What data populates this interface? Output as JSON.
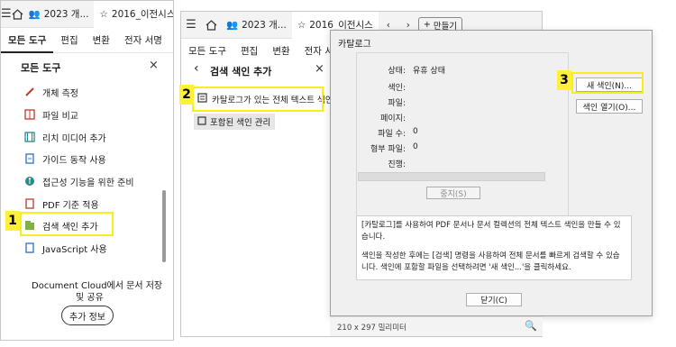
{
  "window1": {
    "tabs": [
      "2023 개...",
      "2016_이전시스"
    ],
    "menu": [
      "모든 도구",
      "편집",
      "변환",
      "전자 서명"
    ],
    "panel_title": "모든 도구",
    "tools": [
      {
        "label": "개체 측정",
        "icon": "ruler-icon"
      },
      {
        "label": "파일 비교",
        "icon": "compare-icon"
      },
      {
        "label": "리치 미디어 추가",
        "icon": "film-icon"
      },
      {
        "label": "가이드 동작 사용",
        "icon": "guide-icon"
      },
      {
        "label": "접근성 기능을 위한 준비",
        "icon": "accessibility-icon"
      },
      {
        "label": "PDF 기준 적용",
        "icon": "pdf-standard-icon"
      },
      {
        "label": "검색 색인 추가",
        "icon": "index-icon"
      },
      {
        "label": "JavaScript 사용",
        "icon": "javascript-icon"
      }
    ],
    "promo_text_1": "Document Cloud에서 문서 저장",
    "promo_text_2": "및 공유",
    "more_info": "추가 정보"
  },
  "window2": {
    "tabs": [
      "2023 개...",
      "2016_이전시스"
    ],
    "new_label": "만들기",
    "menu": [
      "모든 도구",
      "편집",
      "변환",
      "전자 서명"
    ],
    "panel_title": "검색 색인 추가",
    "options": [
      {
        "label": "카탈로그가 있는 전체 텍스트 색인",
        "icon": "catalog-icon"
      },
      {
        "label": "포함된 색인 관리",
        "icon": "embedded-index-icon"
      }
    ],
    "status_text": "210 x 297 밀리미터"
  },
  "dialog": {
    "title": "카탈로그",
    "fields": [
      {
        "label": "상태:",
        "value": "유휴 상태"
      },
      {
        "label": "색인:",
        "value": ""
      },
      {
        "label": "파일:",
        "value": ""
      },
      {
        "label": "페이지:",
        "value": ""
      },
      {
        "label": "파일 수:",
        "value": "0"
      },
      {
        "label": "형부 파일:",
        "value": "0"
      },
      {
        "label": "진행:",
        "value": ""
      }
    ],
    "stop_button": "중지(S)",
    "new_index_button": "새 색인(N)...",
    "open_index_button": "색인 열기(O)...",
    "description_1": "[카탈로그]를 사용하여 PDF 문서나 문서 컬렉션의 전체 텍스트 색인을 만들 수 있습니다.",
    "description_2": "색인을 작성한 후에는 [검색] 명령을 사용하여 전체 문서를 빠르게 검색할 수 있습니다. 색인에 포함할 파일을 선택하려면 '새 색인...'을 클릭하세요.",
    "close_button": "닫기(C)"
  },
  "annotations": {
    "step1": "1",
    "step2": "2",
    "step3": "3",
    "color": "#fff13a"
  }
}
